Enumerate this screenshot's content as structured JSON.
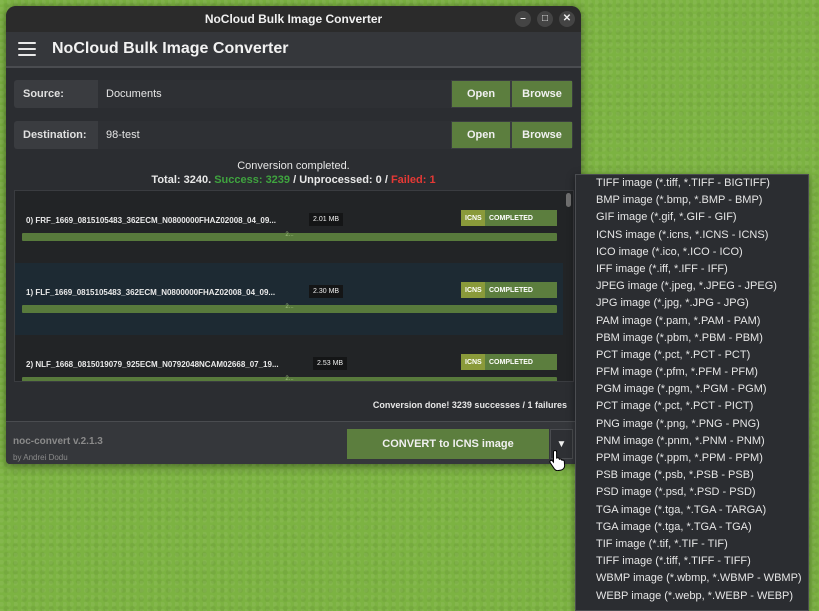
{
  "window": {
    "title": "NoCloud Bulk Image Converter"
  },
  "appbar": {
    "title": "NoCloud Bulk Image Converter"
  },
  "source": {
    "label": "Source:",
    "value": "Documents",
    "open_label": "Open",
    "browse_label": "Browse"
  },
  "destination": {
    "label": "Destination:",
    "value": "98-test",
    "open_label": "Open",
    "browse_label": "Browse"
  },
  "status": {
    "line1": "Conversion completed.",
    "total": "Total: 3240.",
    "success": "Success: 3239",
    "sep1": "/",
    "unprocessed": "Unprocessed: 0 /",
    "failed": "Failed: 1"
  },
  "items": [
    {
      "name": "0) FRF_1669_0815105483_362ECM_N0800000FHAZ02008_04_09...",
      "size": "2.01 MB",
      "format": "ICNS",
      "status": "COMPLETED",
      "progress": 1.0,
      "progress_label": "2..."
    },
    {
      "name": "1) FLF_1669_0815105483_362ECM_N0800000FHAZ02008_04_09...",
      "size": "2.30 MB",
      "format": "ICNS",
      "status": "COMPLETED",
      "progress": 1.0,
      "progress_label": "2..."
    },
    {
      "name": "2) NLF_1668_0815019079_925ECM_N0792048NCAM02668_07_19...",
      "size": "2.53 MB",
      "format": "ICNS",
      "status": "COMPLETED",
      "progress": 1.0,
      "progress_label": "2..."
    }
  ],
  "done_message": "Conversion done! 3239 successes / 1 failures",
  "footer": {
    "version": "noc-convert v.2.1.3",
    "author": "by Andrei Dodu",
    "convert_label": "CONVERT to ICNS image",
    "dropdown_glyph": "▼"
  },
  "format_menu": [
    "TIFF image (*.tiff, *.TIFF - BIGTIFF)",
    "BMP image (*.bmp, *.BMP - BMP)",
    "GIF image (*.gif, *.GIF - GIF)",
    "ICNS image (*.icns, *.ICNS - ICNS)",
    "ICO image (*.ico, *.ICO - ICO)",
    "IFF image (*.iff, *.IFF - IFF)",
    "JPEG image (*.jpeg, *.JPEG - JPEG)",
    "JPG image (*.jpg, *.JPG - JPG)",
    "PAM image (*.pam, *.PAM - PAM)",
    "PBM image (*.pbm, *.PBM - PBM)",
    "PCT image (*.pct, *.PCT - PCT)",
    "PFM image (*.pfm, *.PFM - PFM)",
    "PGM image (*.pgm, *.PGM - PGM)",
    "PCT image (*.pct, *.PCT - PICT)",
    "PNG image (*.png, *.PNG - PNG)",
    "PNM image (*.pnm, *.PNM - PNM)",
    "PPM image (*.ppm, *.PPM - PPM)",
    "PSB image (*.psb, *.PSB - PSB)",
    "PSD image (*.psd, *.PSD - PSD)",
    "TGA image (*.tga, *.TGA - TARGA)",
    "TGA image (*.tga, *.TGA - TGA)",
    "TIF image (*.tif, *.TIF - TIF)",
    "TIFF image (*.tiff, *.TIFF - TIFF)",
    "WBMP image (*.wbmp, *.WBMP - WBMP)",
    "WEBP image (*.webp, *.WEBP - WEBP)"
  ],
  "colors": {
    "accent_green": "#5c7e3e",
    "success": "#3fa33f",
    "failed": "#e53935",
    "desktop": "#7cb342"
  }
}
